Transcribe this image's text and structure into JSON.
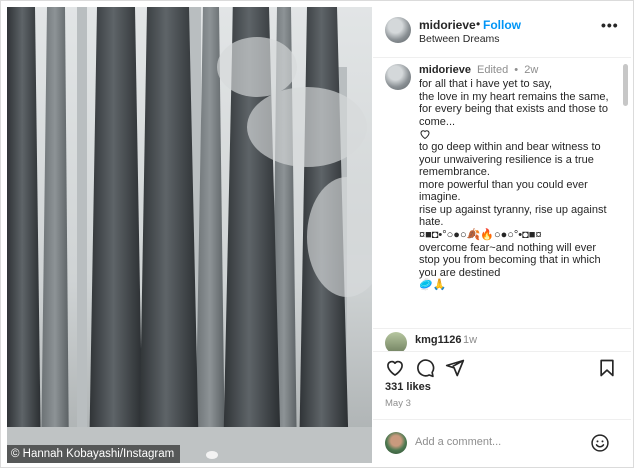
{
  "post": {
    "username": "midorieve",
    "follow_label": "Follow",
    "location": "Between Dreams",
    "more_icon": "more-horizontal-icon",
    "credit": "© Hannah Kobayashi/Instagram"
  },
  "caption": {
    "username": "midorieve",
    "edited": "Edited",
    "time": "2w",
    "lines": [
      "for all that i have yet to say,",
      "the love in my heart remains the same,",
      "for every being that exists and those to",
      "come...",
      "to go deep within and bear witness to",
      "your unwaivering resilience is a true",
      "remembrance.",
      "more powerful than you could ever",
      "imagine.",
      "rise up against tyranny, rise up against",
      "hate.",
      "overcome fear~and nothing will ever",
      "stop you from becoming that in which",
      "you are destined"
    ],
    "symbol_line": "¤■◘•°○●○🍂🔥○●○°•◘■¤",
    "closing_emojis": "🥏🙏"
  },
  "comment": {
    "username": "kmg1126",
    "time": "1w"
  },
  "actions": {
    "like_icon": "heart-icon",
    "comment_icon": "comment-icon",
    "share_icon": "send-icon",
    "save_icon": "bookmark-icon"
  },
  "likes": "331 likes",
  "date": "May 3",
  "add_comment": {
    "placeholder": "Add a comment...",
    "emoji_icon": "smiley-icon"
  },
  "colors": {
    "accent": "#0095f6",
    "text": "#262626",
    "muted": "#8e8e8e",
    "border": "#dbdbdb"
  }
}
